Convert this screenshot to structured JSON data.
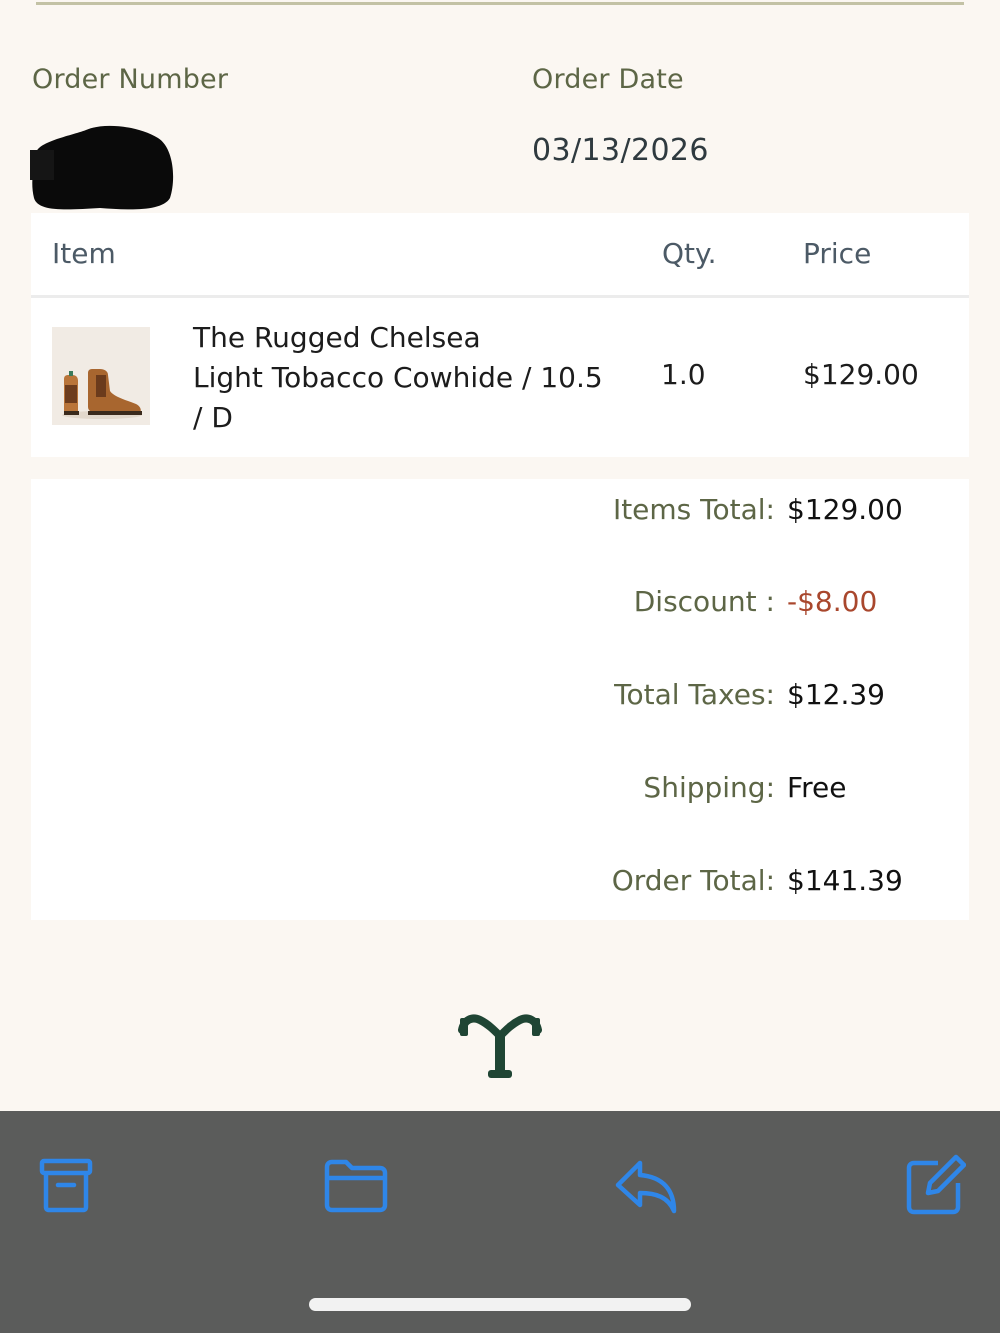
{
  "order_meta": {
    "order_number_label": "Order Number",
    "order_number_value": "[redacted]",
    "order_date_label": "Order Date",
    "order_date_value": "03/13/2026"
  },
  "items_table": {
    "headers": {
      "item": "Item",
      "qty": "Qty.",
      "price": "Price"
    },
    "rows": [
      {
        "thumbnail_icon": "chelsea-boot-image",
        "name_lines": [
          "The Rugged Chelsea",
          "Light Tobacco Cowhide / 10.5",
          "/ D"
        ],
        "qty": "1.0",
        "price": "$129.00"
      }
    ]
  },
  "totals": {
    "items_total_label": "Items Total:",
    "items_total_value": "$129.00",
    "discount_label": "Discount :",
    "discount_value": "-$8.00",
    "taxes_label": "Total Taxes:",
    "taxes_value": "$12.39",
    "shipping_label": "Shipping:",
    "shipping_value": "Free",
    "order_total_label": "Order Total:",
    "order_total_value": "$141.39"
  },
  "brand": {
    "logo_icon": "brand-y-logo"
  },
  "toolbar": {
    "buttons": [
      {
        "icon": "archive-icon"
      },
      {
        "icon": "folder-icon"
      },
      {
        "icon": "reply-icon"
      },
      {
        "icon": "compose-icon"
      }
    ]
  },
  "colors": {
    "page_background": "#fbf7f2",
    "card_background": "#ffffff",
    "label_olive": "#5d6646",
    "discount_red": "#a9472d",
    "toolbar_background": "#5b5c5b",
    "toolbar_icon_blue": "#2f86e8",
    "logo_green": "#1f4534"
  }
}
